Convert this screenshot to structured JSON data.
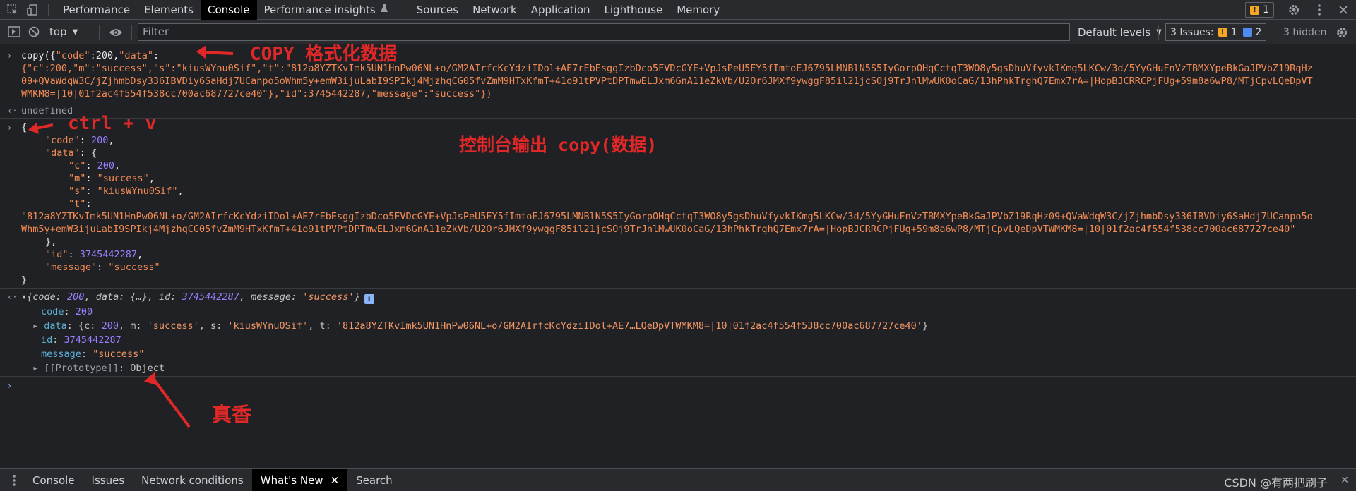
{
  "topbar": {
    "tabs": [
      "Performance",
      "Elements",
      "Console",
      "Performance insights",
      "Sources",
      "Network",
      "Application",
      "Lighthouse",
      "Memory"
    ],
    "active_tab": "Console",
    "issues_count": "1"
  },
  "toolbar": {
    "context": "top",
    "filter_placeholder": "Filter",
    "levels": "Default levels",
    "issues_label": "3 Issues:",
    "issues_warn": "1",
    "issues_info": "2",
    "hidden": "3 hidden"
  },
  "console": {
    "cmd1_line1_a": "copy({",
    "cmd1_line1_b": "\"code\"",
    "cmd1_line1_c": ":200,",
    "cmd1_line1_d": "\"data\"",
    "cmd1_line1_e": ":",
    "cmd1_line2": "{\"c\":200,\"m\":\"success\",\"s\":\"kiusWYnu0Sif\",\"t\":\"812a8YZTKvImk5UN1HnPw06NL+o/GM2AIrfcKcYdziIDol+AE7rEbEsggIzbDco5FVDcGYE+VpJsPeU5EY5fImtoEJ6795LMNBlN5S5IyGorpOHqCctqT3WO8y5gsDhuVfyvkIKmg5LKCw/3d/5YyGHuFnVzTBMXYpeBkGaJPVbZ19RqHz",
    "cmd1_line3": "09+QVaWdqW3C/jZjhmbDsy336IBVDiy6SaHdj7UCanpo5oWhm5y+emW3ijuLabI9SPIkj4MjzhqCG05fvZmM9HTxKfmT+41o91tPVPtDPTmwELJxm6GnA11eZkVb/U2Or6JMXf9ywggF85il21jcSOj9TrJnlMwUK0oCaG/13hPhkTrghQ7Emx7rA=|HopBJCRRCPjFUg+59m8a6wP8/MTjCpvLQeDpVT",
    "cmd1_line4": "WMKM8=|10|01f2ac4f554f538cc700ac687727ce40\"},\"id\":3745442287,\"message\":\"success\"})",
    "undefined": "undefined",
    "json_open": "{",
    "json_code_key": "\"code\"",
    "json_code_val": "200",
    "json_data_key": "\"data\"",
    "json_c_key": "\"c\"",
    "json_c_val": "200",
    "json_m_key": "\"m\"",
    "json_m_val": "\"success\"",
    "json_s_key": "\"s\"",
    "json_s_val": "\"kiusWYnu0Sif\"",
    "json_t_key": "\"t\"",
    "json_t_val1": "\"812a8YZTKvImk5UN1HnPw06NL+o/GM2AIrfcKcYdziIDol+AE7rEbEsggIzbDco5FVDcGYE+VpJsPeU5EY5fImtoEJ6795LMNBlN5S5IyGorpOHqCctqT3WO8y5gsDhuVfyvkIKmg5LKCw/3d/5YyGHuFnVzTBMXYpeBkGaJPVbZ19RqHz09+QVaWdqW3C/jZjhmbDsy336IBVDiy6SaHdj7UCanpo5o",
    "json_t_val2": "Whm5y+emW3ijuLabI9SPIkj4MjzhqCG05fvZmM9HTxKfmT+41o91tPVPtDPTmwELJxm6GnA11eZkVb/U2Or6JMXf9ywggF85il21jcSOj9TrJnlMwUK0oCaG/13hPhkTrghQ7Emx7rA=|HopBJCRRCPjFUg+59m8a6wP8/MTjCpvLQeDpVTWMKM8=|10|01f2ac4f554f538cc700ac687727ce40\"",
    "json_inner_close": "},",
    "json_id_key": "\"id\"",
    "json_id_val": "3745442287",
    "json_msg_key": "\"message\"",
    "json_msg_val": "\"success\"",
    "json_close": "}",
    "obj_summary_a": "{code: ",
    "obj_summary_code": "200",
    "obj_summary_b": ", data: {…}, id: ",
    "obj_summary_id": "3745442287",
    "obj_summary_c": ", message: ",
    "obj_summary_msg": "'success'",
    "obj_summary_d": "}",
    "prop_code_key": "code",
    "prop_code_val": "200",
    "prop_data_key": "data",
    "prop_data_a": "{c: ",
    "prop_data_c": "200",
    "prop_data_b": ", m: ",
    "prop_data_m": "'success'",
    "prop_data_s_label": ", s: ",
    "prop_data_s": "'kiusWYnu0Sif'",
    "prop_data_t_label": ", t: ",
    "prop_data_t": "'812a8YZTKvImk5UN1HnPw06NL+o/GM2AIrfcKcYdziIDol+AE7…LQeDpVTWMKM8=|10|01f2ac4f554f538cc700ac687727ce40'",
    "prop_data_close": "}",
    "prop_id_key": "id",
    "prop_id_val": "3745442287",
    "prop_msg_key": "message",
    "prop_msg_val": "\"success\"",
    "prop_proto_key": "[[Prototype]]",
    "prop_proto_val": "Object"
  },
  "annotations": {
    "copy_note": "COPY 格式化数据",
    "paste_note": "ctrl + v",
    "output_note": "控制台输出 copy(数据)",
    "good_note": "真香"
  },
  "bottombar": {
    "tabs": [
      "Console",
      "Issues",
      "Network conditions",
      "What's New",
      "Search"
    ],
    "active_tab": "What's New",
    "watermark": "CSDN @有两把刷子"
  }
}
